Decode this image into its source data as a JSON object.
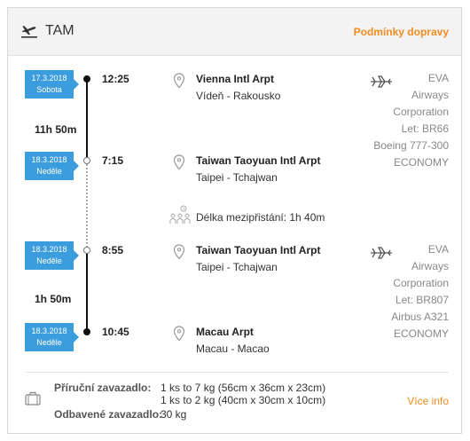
{
  "header": {
    "title": "TAM",
    "link": "Podmínky dopravy"
  },
  "segments": [
    {
      "dep": {
        "date": "17.3.2018",
        "day": "Sobota",
        "time": "12:25",
        "airport": "Vienna Intl Arpt",
        "city": "Vídeň - Rakousko"
      },
      "duration": "11h 50m",
      "arr": {
        "date": "18.3.2018",
        "day": "Neděle",
        "time": "7:15",
        "airport": "Taiwan Taoyuan Intl Arpt",
        "city": "Taipei - Tchajwan"
      },
      "airline": [
        "EVA",
        "Airways",
        "Corporation"
      ],
      "flight": "Let: BR66",
      "aircraft": "Boeing 777-300",
      "cabin": "ECONOMY"
    },
    {
      "dep": {
        "date": "18.3.2018",
        "day": "Neděle",
        "time": "8:55",
        "airport": "Taiwan Taoyuan Intl Arpt",
        "city": "Taipei - Tchajwan"
      },
      "duration": "1h 50m",
      "arr": {
        "date": "18.3.2018",
        "day": "Neděle",
        "time": "10:45",
        "airport": "Macau Arpt",
        "city": "Macau - Macao"
      },
      "airline": [
        "EVA",
        "Airways",
        "Corporation"
      ],
      "flight": "Let: BR807",
      "aircraft": "Airbus A321",
      "cabin": "ECONOMY"
    }
  ],
  "layover": "Délka mezipřistání: 1h 40m",
  "luggage": {
    "carry_label": "Příruční zavazadlo:",
    "carry_values": [
      "1 ks to 7 kg (56cm x 36cm x 23cm)",
      "1 ks to 2 kg (40cm x 30cm x 10cm)"
    ],
    "checked_label": "Odbavené zavazadlo:",
    "checked_value": "30 kg",
    "more_link": "Více info"
  },
  "colors": {
    "accent": "#f28c1e",
    "badge": "#3b9ddd"
  },
  "icons": {
    "header": "plane-takeoff-icon",
    "location": "map-pin-icon",
    "layover": "waiting-people-icon",
    "airline": "plane-icon",
    "luggage": "suitcase-icon"
  }
}
